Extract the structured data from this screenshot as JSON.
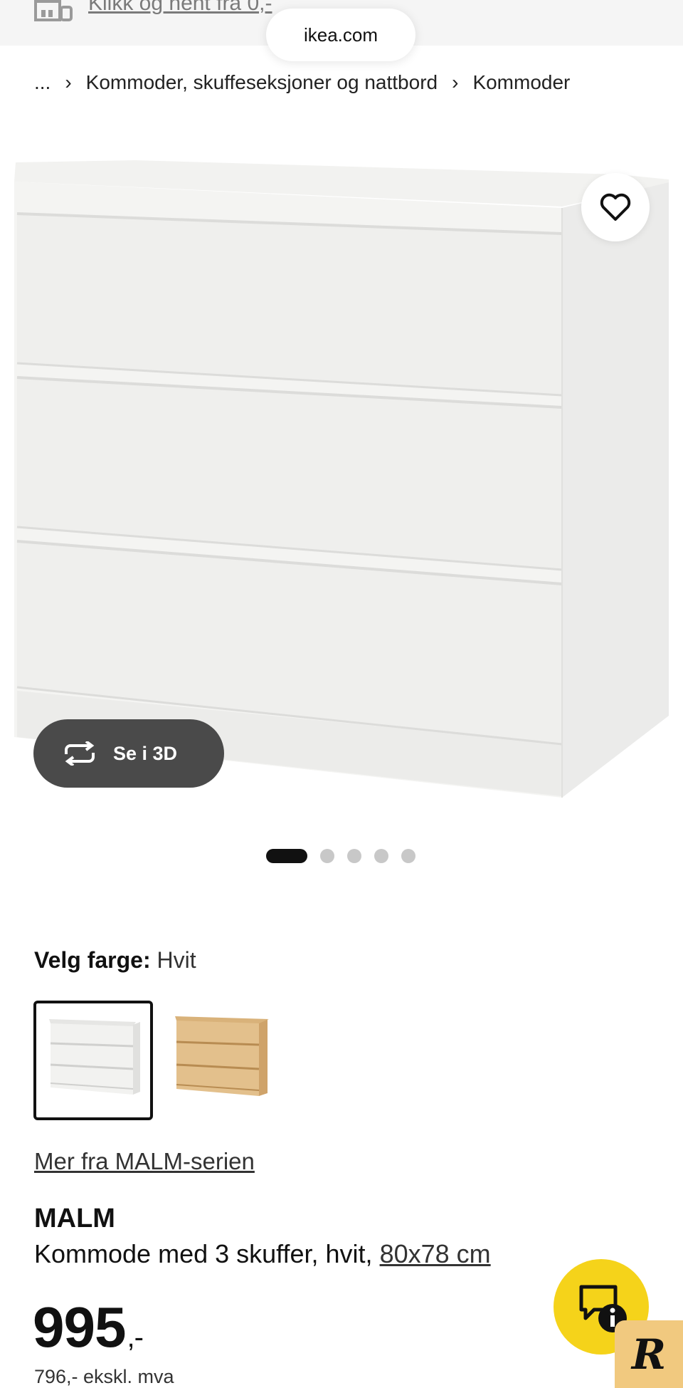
{
  "topbar": {
    "store_link": "Klikk og hent fra 0,-",
    "url": "ikea.com"
  },
  "breadcrumb": {
    "ellipsis": "...",
    "items": [
      "Kommoder, skuffeseksjoner og nattbord",
      "Kommoder"
    ]
  },
  "gallery": {
    "view3d_label": "Se i 3D",
    "dot_count": 5,
    "active_dot": 1
  },
  "color": {
    "label": "Velg farge:",
    "value": "Hvit",
    "options": [
      "white",
      "oak"
    ]
  },
  "series_link": "Mer fra MALM-serien",
  "product": {
    "name": "MALM",
    "description": "Kommode med 3 skuffer, hvit,",
    "size": "80x78 cm",
    "price": "995",
    "price_suffix": ",-",
    "price_ex_vat": "796,- ekskl. mva"
  },
  "badge_letter": "R",
  "colors": {
    "chat_yellow": "#f5d31a",
    "view3d_bg": "#4a4a4a",
    "badge_bg": "#f1c97f"
  },
  "icons": [
    "store-icon",
    "chevron-right-icon",
    "heart-icon",
    "rotate-3d-icon",
    "chat-icon",
    "info-icon"
  ]
}
